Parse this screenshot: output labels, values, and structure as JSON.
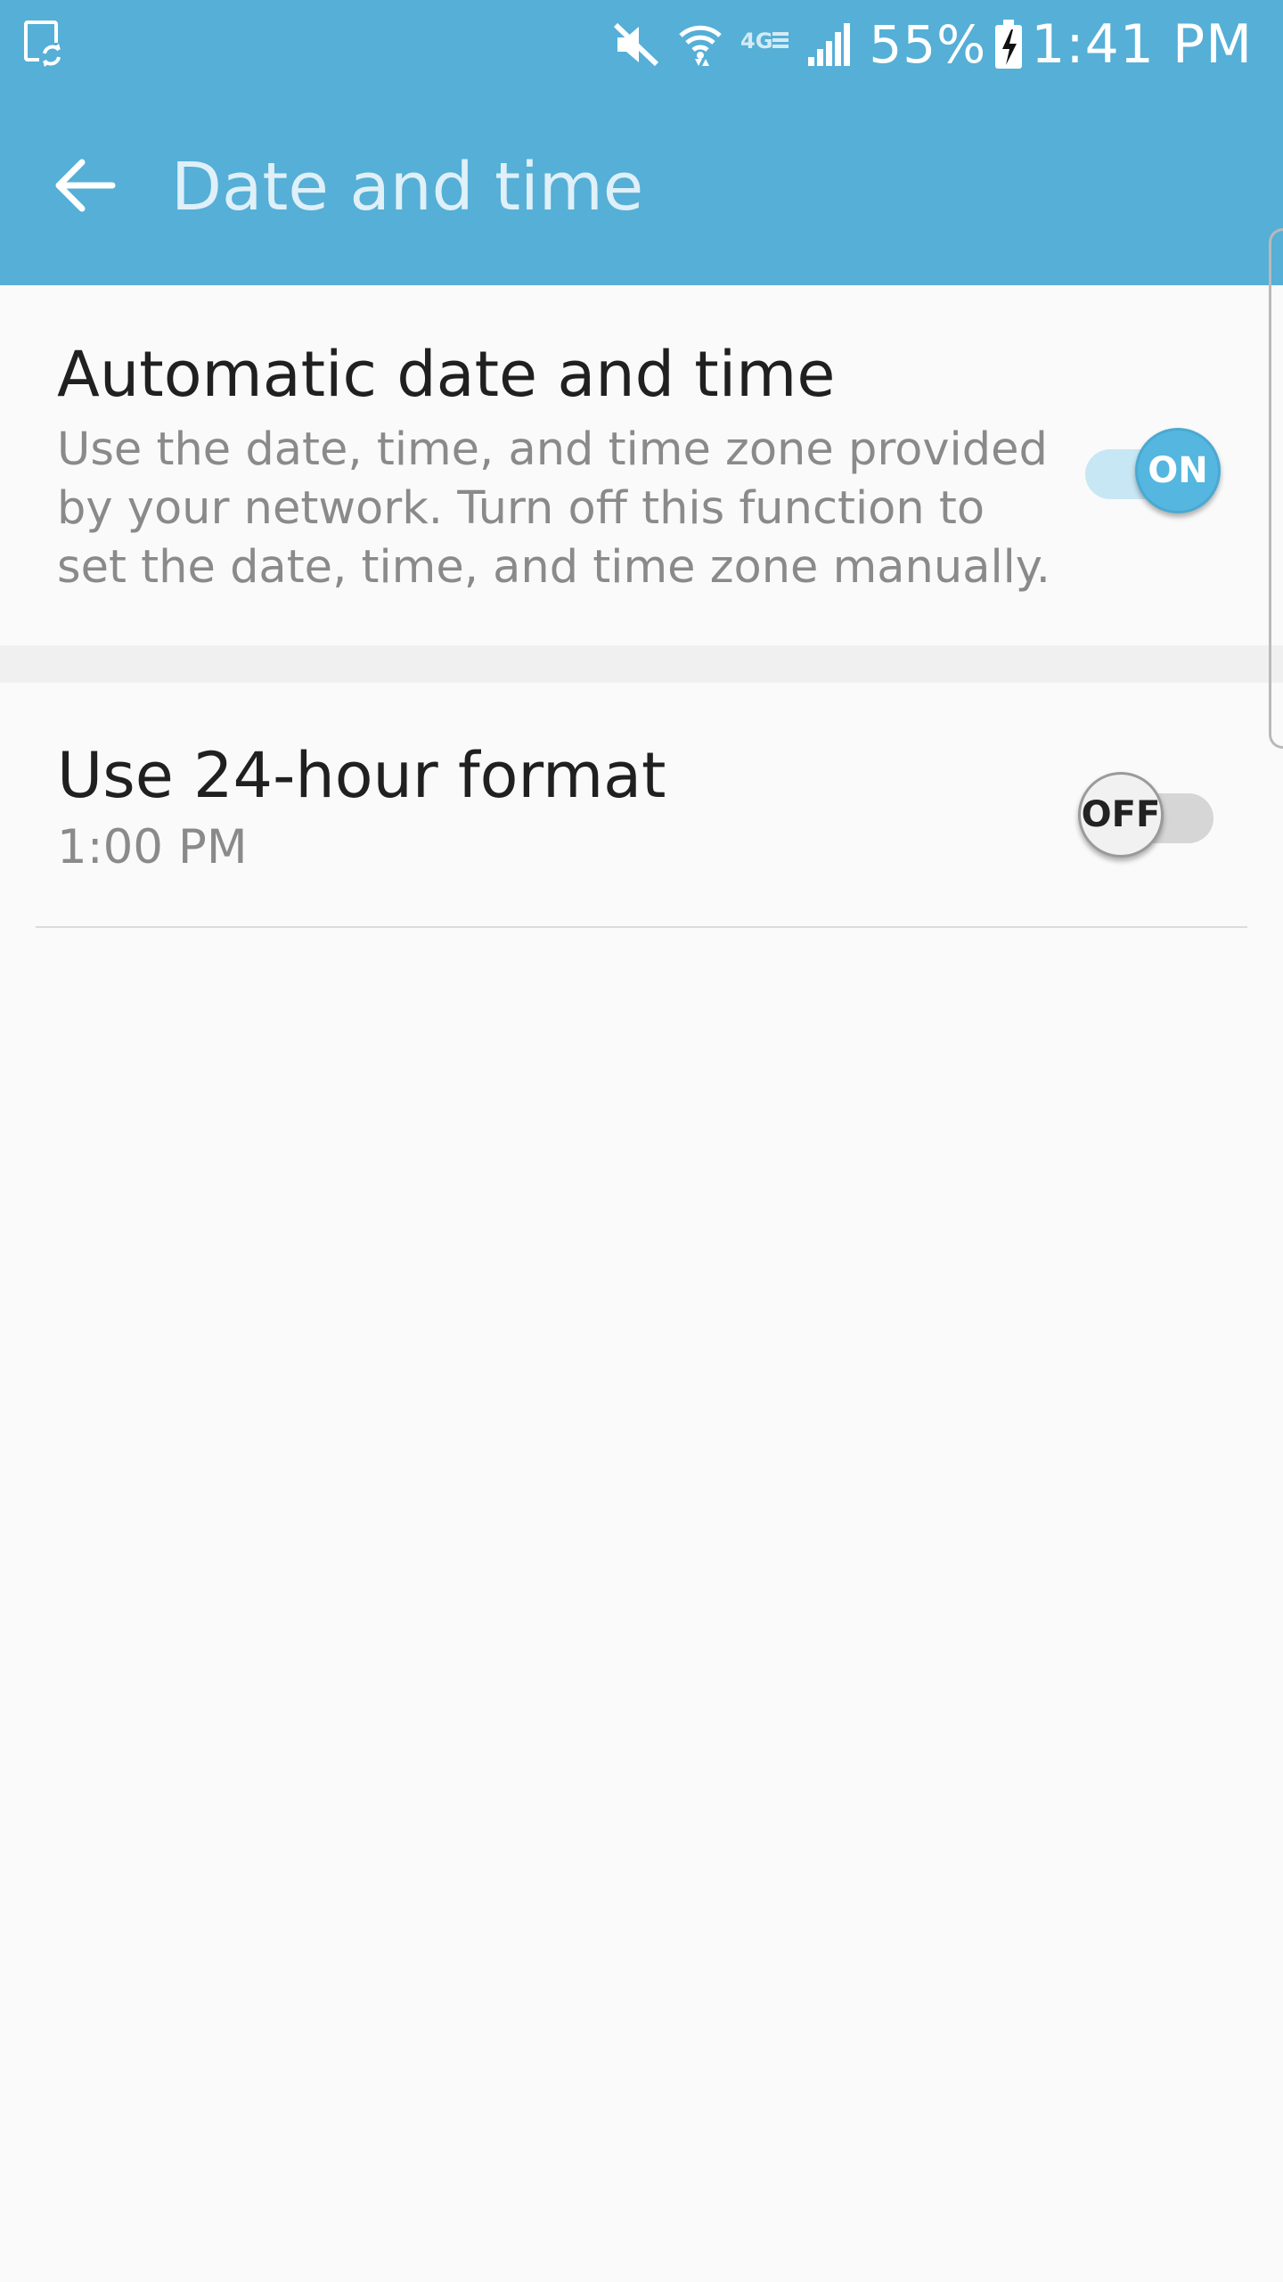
{
  "status_bar": {
    "battery_percent": "55%",
    "time": "1:41 PM",
    "network_label": "4G",
    "icons": [
      "screen-rotation-icon",
      "mute-icon",
      "wifi-icon",
      "lte-icon",
      "signal-icon",
      "battery-charging-icon"
    ]
  },
  "app_bar": {
    "title": "Date and time",
    "back_icon": "arrow-left-icon"
  },
  "settings": {
    "automatic": {
      "title": "Automatic date and time",
      "description": "Use the date, time, and time zone provided by your network. Turn off this function to set the date, time, and time zone manually.",
      "switch_label": "ON",
      "enabled": true
    },
    "format_24h": {
      "title": "Use 24-hour format",
      "subtitle": "1:00 PM",
      "switch_label": "OFF",
      "enabled": false
    }
  },
  "colors": {
    "header": "#55afd6",
    "accent": "#55b6df",
    "background": "#fafafa"
  }
}
